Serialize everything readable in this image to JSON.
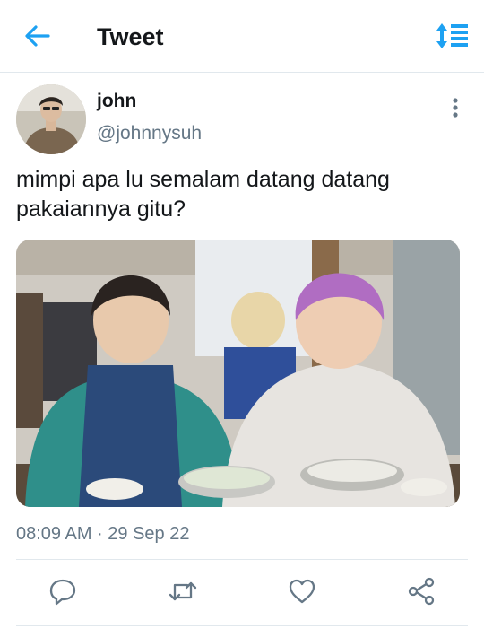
{
  "header": {
    "title": "Tweet",
    "back_icon": "arrow-left-icon",
    "sort_icon": "sort-icon",
    "accent_color": "#1da1f2"
  },
  "tweet": {
    "author": {
      "display_name": "john",
      "handle": "@johnnysuh"
    },
    "text": "mimpi apa lu semalam datang datang\npakaiannya gitu?",
    "timestamp": "08:09 AM · 29 Sep 22",
    "media_type": "photo"
  },
  "actions": [
    {
      "icon": "reply-icon"
    },
    {
      "icon": "retweet-icon"
    },
    {
      "icon": "like-icon"
    },
    {
      "icon": "share-icon"
    }
  ],
  "colors": {
    "text_primary": "#14171a",
    "text_secondary": "#657786",
    "divider": "#e1e8ed"
  }
}
